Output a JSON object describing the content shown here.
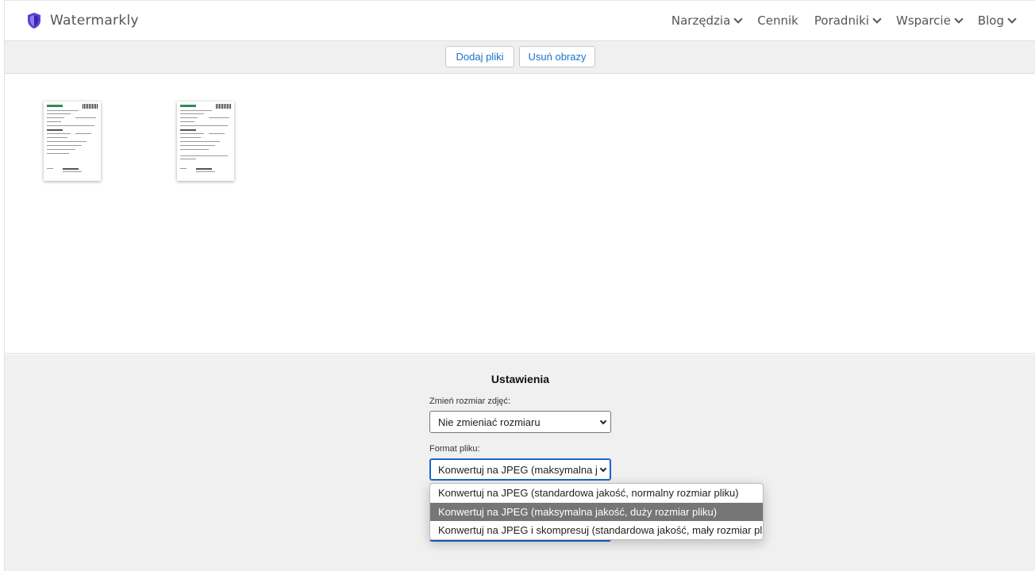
{
  "brand": {
    "name": "Watermarkly",
    "accent": "#5b3fd6"
  },
  "nav": {
    "items": [
      {
        "label": "Narzędzia",
        "has_dropdown": true
      },
      {
        "label": "Cennik",
        "has_dropdown": false
      },
      {
        "label": "Poradniki",
        "has_dropdown": true
      },
      {
        "label": "Wsparcie",
        "has_dropdown": true
      },
      {
        "label": "Blog",
        "has_dropdown": true
      }
    ]
  },
  "toolbar": {
    "add_label": "Dodaj pliki",
    "remove_label": "Usuń obrazy",
    "link_color": "#1a73c9"
  },
  "images": [
    {
      "name": "document-thumbnail-1"
    },
    {
      "name": "document-thumbnail-2"
    }
  ],
  "settings": {
    "title": "Ustawienia",
    "resize_label": "Zmień rozmiar zdjęć:",
    "resize_value": "Nie zmieniać rozmiaru",
    "format_label": "Format pliku:",
    "format_value": "Konwertuj na JPEG (maksymalna jakość, duży rozmiar pliku)",
    "format_options": [
      "Konwertuj na JPEG (standardowa jakość, normalny rozmiar pliku)",
      "Konwertuj na JPEG (maksymalna jakość, duży rozmiar pliku)",
      "Konwertuj na JPEG i skompresuj (standardowa jakość, mały rozmiar pliku)"
    ],
    "selected_option_index": 1
  }
}
